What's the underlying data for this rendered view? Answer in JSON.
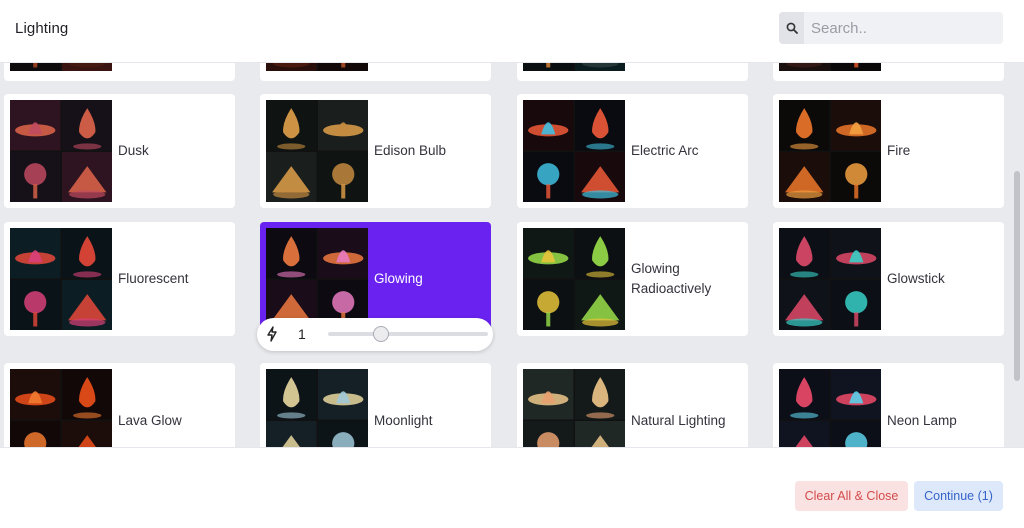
{
  "header": {
    "title": "Lighting",
    "search_placeholder": "Search.."
  },
  "cards": [
    {
      "label": "",
      "palette": [
        "#3a1410",
        "#b94a22",
        "#0e0b0d",
        "#4a1c12"
      ]
    },
    {
      "label": "",
      "palette": [
        "#2a0e0a",
        "#c0562a",
        "#120808",
        "#5a2010"
      ]
    },
    {
      "label": "",
      "palette": [
        "#0b1c1f",
        "#e08a3a",
        "#0a0f12",
        "#314144"
      ]
    },
    {
      "label": "",
      "palette": [
        "#1a0f0f",
        "#e85a2a",
        "#0b0809",
        "#3d1e18"
      ]
    },
    {
      "label": "Dusk",
      "palette": [
        "#2e1420",
        "#e0654a",
        "#161018",
        "#c04a60"
      ]
    },
    {
      "label": "Edison Bulb",
      "palette": [
        "#1a1f1e",
        "#e2a04a",
        "#0f1412",
        "#c48a40"
      ]
    },
    {
      "label": "Electric Arc",
      "palette": [
        "#180a0c",
        "#f05a3a",
        "#0a0b10",
        "#40c0e0"
      ]
    },
    {
      "label": "Fire",
      "palette": [
        "#1a0d0a",
        "#f0782a",
        "#0c0909",
        "#f2a040"
      ]
    },
    {
      "label": "Fluorescent",
      "palette": [
        "#0c1e24",
        "#e8483a",
        "#0a1418",
        "#d8407a"
      ]
    },
    {
      "label": "Glowing",
      "palette": [
        "#1a0c18",
        "#f07a40",
        "#0d0a12",
        "#e87ac0"
      ]
    },
    {
      "label": "Glowing Radioactively",
      "palette": [
        "#101816",
        "#9ae04a",
        "#0c1012",
        "#e8c43a"
      ]
    },
    {
      "label": "Glowstick",
      "palette": [
        "#10121a",
        "#e04a6a",
        "#0c1016",
        "#38d0c8"
      ]
    },
    {
      "label": "Lava Glow",
      "palette": [
        "#1c0c0a",
        "#f0501a",
        "#120808",
        "#f07a30"
      ]
    },
    {
      "label": "Moonlight",
      "palette": [
        "#142026",
        "#e8d8a0",
        "#0d1418",
        "#a0c8d8"
      ]
    },
    {
      "label": "Natural Lighting",
      "palette": [
        "#202826",
        "#f0c88a",
        "#141a1a",
        "#e8a070"
      ]
    },
    {
      "label": "Neon Lamp",
      "palette": [
        "#101420",
        "#f04a6a",
        "#0c0e18",
        "#5ad0e8"
      ]
    }
  ],
  "weight_slider": {
    "value": "1",
    "level": 0.33,
    "icon": "bolt-icon"
  },
  "footer": {
    "clear_label": "Clear All & Close",
    "continue_label": "Continue (1)"
  },
  "colors": {
    "accent": "#6a22f0",
    "clear_bg": "#fbe2e2",
    "clear_fg": "#d24b4b",
    "continue_bg": "#dde8fb",
    "continue_fg": "#3764c8"
  }
}
